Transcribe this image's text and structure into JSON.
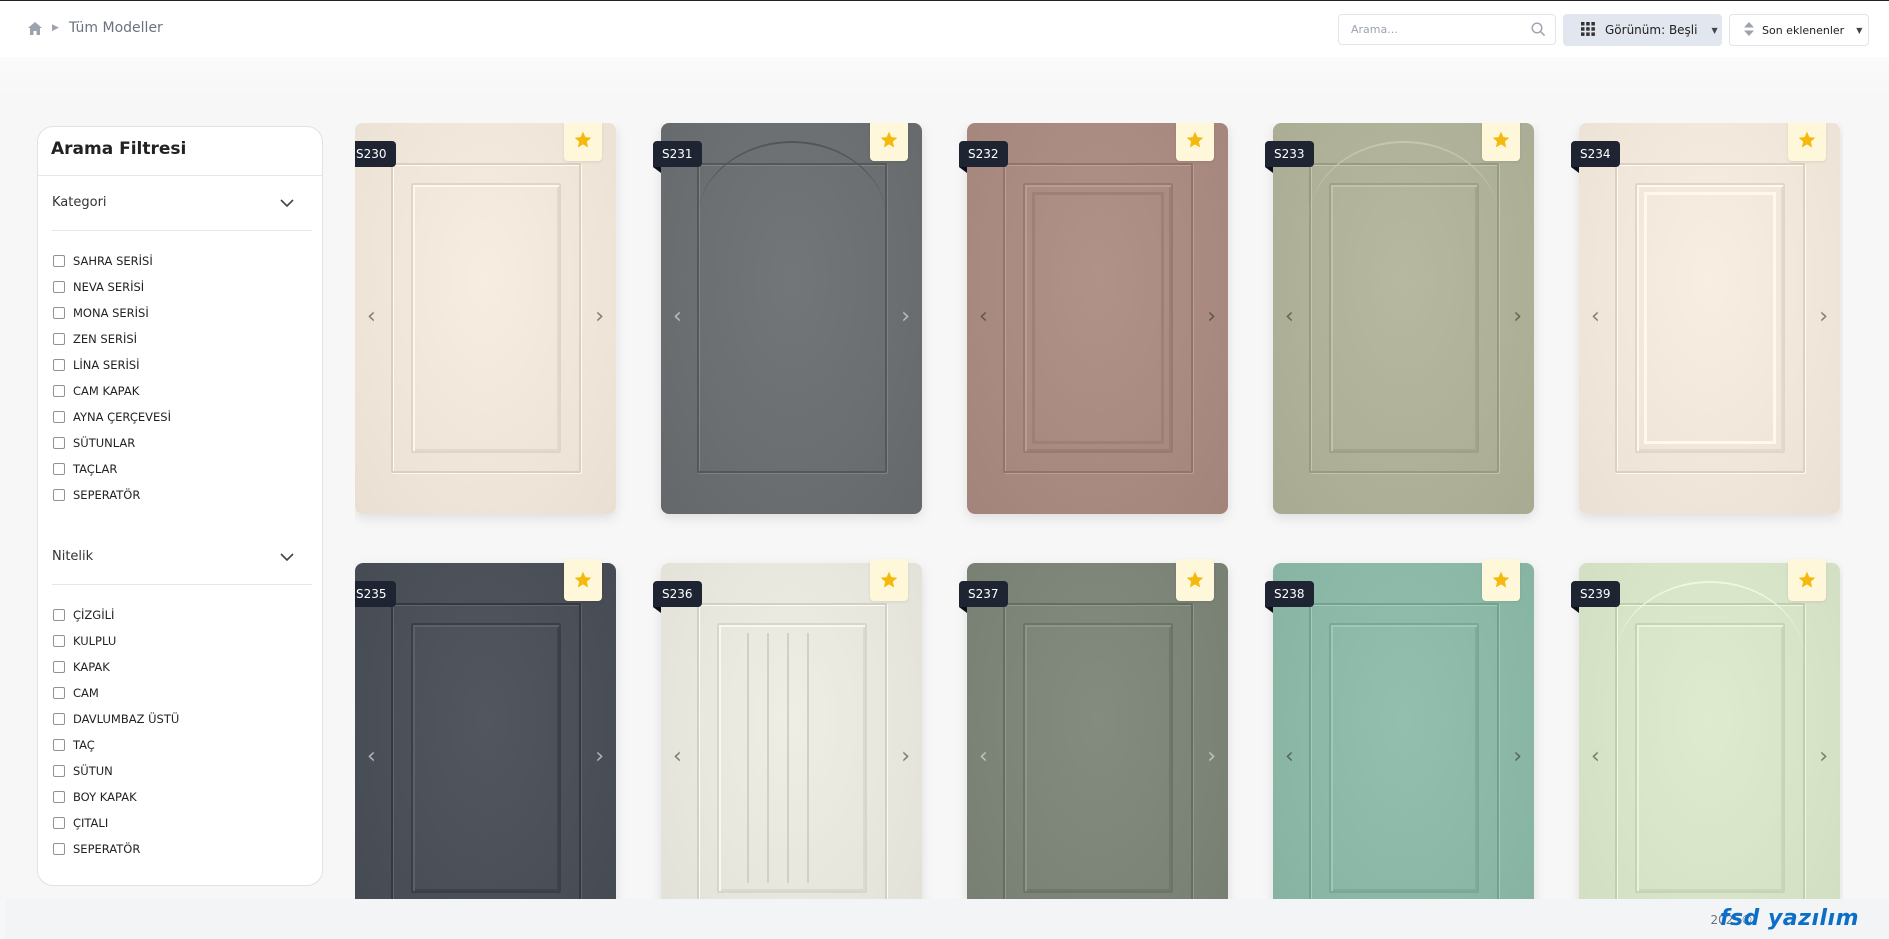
{
  "breadcrumb": {
    "home_icon": "home-icon",
    "current": "Tüm Modeller"
  },
  "search": {
    "placeholder": "Arama..."
  },
  "view_button": {
    "label": "Görünüm: Beşli"
  },
  "sort_button": {
    "label": "Son eklenenler"
  },
  "sidebar": {
    "title": "Arama Filtresi",
    "sections": [
      {
        "title": "Kategori",
        "options": [
          "SAHRA SERİSİ",
          "NEVA SERİSİ",
          "MONA SERİSİ",
          "ZEN SERİSİ",
          "LİNA SERİSİ",
          "CAM KAPAK",
          "AYNA ÇERÇEVESİ",
          "SÜTUNLAR",
          "TAÇLAR",
          "SEPERATÖR"
        ]
      },
      {
        "title": "Nitelik",
        "options": [
          "ÇİZGİLİ",
          "KULPLU",
          "KAPAK",
          "CAM",
          "DAVLUMBAZ ÜSTÜ",
          "TAÇ",
          "SÜTUN",
          "BOY KAPAK",
          "ÇITALI",
          "SEPERATÖR"
        ]
      }
    ]
  },
  "products": [
    {
      "code": "S230",
      "color": "#efe5d8",
      "style": "raised",
      "dark": false
    },
    {
      "code": "S231",
      "color": "#6b6e70",
      "style": "arch-flat",
      "dark": true
    },
    {
      "code": "S232",
      "color": "#a98a80",
      "style": "raised-double",
      "dark": false
    },
    {
      "code": "S233",
      "color": "#aeb197",
      "style": "arch",
      "dark": false
    },
    {
      "code": "S234",
      "color": "#f0e6d9",
      "style": "raised-deep",
      "dark": false
    },
    {
      "code": "S235",
      "color": "#4a4f57",
      "style": "raised",
      "dark": true
    },
    {
      "code": "S236",
      "color": "#e7e6dc",
      "style": "grooved",
      "dark": false
    },
    {
      "code": "S237",
      "color": "#7c8377",
      "style": "raised",
      "dark": true
    },
    {
      "code": "S238",
      "color": "#8bb8a6",
      "style": "raised",
      "dark": false
    },
    {
      "code": "S239",
      "color": "#d6e3c7",
      "style": "arch",
      "dark": false
    }
  ],
  "footer": {
    "year": "2025©",
    "brand": "fsd yazılım"
  }
}
